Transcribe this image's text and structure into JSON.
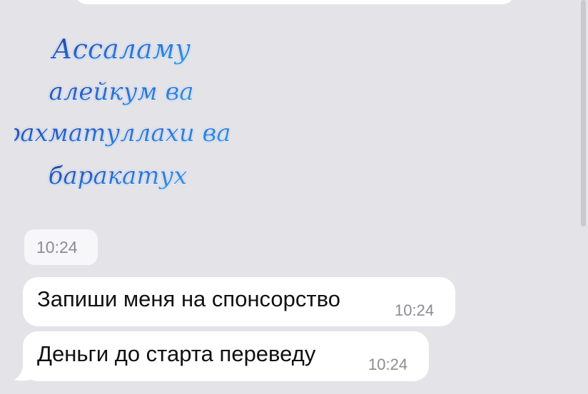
{
  "sticker": {
    "line1": "Ассаламу",
    "line2": "алейкум ва",
    "line3": "рахматуллахи ва",
    "line4": "баракатух"
  },
  "sticker_time": "10:24",
  "messages": [
    {
      "text": "Запиши меня на спонсорство",
      "time": "10:24"
    },
    {
      "text": "Деньги до старта переведу",
      "time": "10:24"
    }
  ],
  "colors": {
    "chat_background": "#e4e4e8",
    "bubble": "#ffffff",
    "time_text": "#8c8c92",
    "sticker_ink_dark": "#1f3b9a",
    "sticker_ink_light": "#3aa0e6"
  }
}
